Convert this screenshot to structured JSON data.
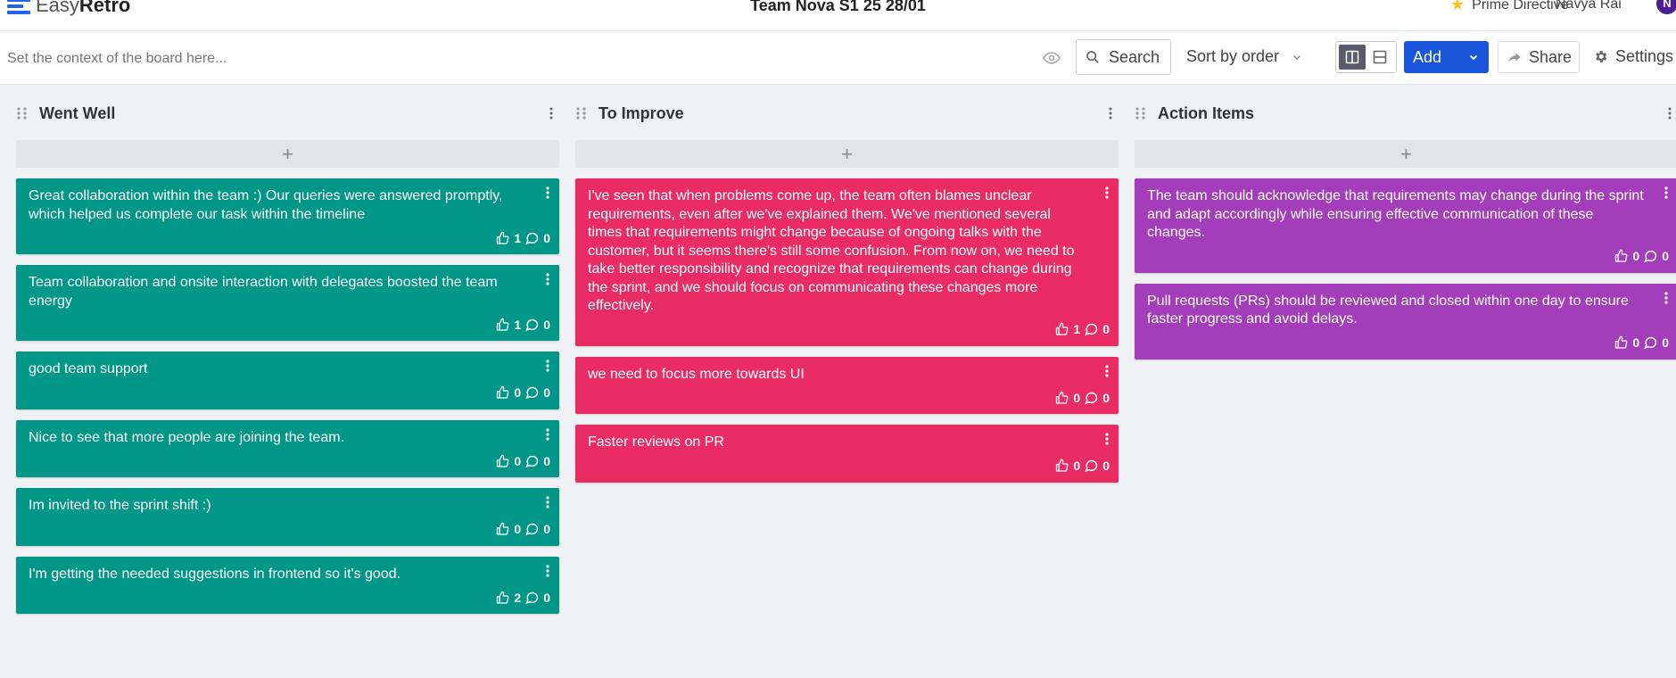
{
  "app": {
    "logo_light": "Easy",
    "logo_bold": "Retro"
  },
  "header": {
    "board_title": "Team Nova S1 25 28/01",
    "prime_directive": "Prime Directive",
    "user_name": "Navya Rai",
    "avatar_initial": "N"
  },
  "toolbar": {
    "context_placeholder": "Set the context of the board here...",
    "search_label": "Search",
    "sort_label": "Sort by order",
    "add_label": "Add",
    "share_label": "Share",
    "settings_label": "Settings"
  },
  "colors": {
    "went_well": "#009688",
    "to_improve": "#e92c64",
    "action_items": "#a33dba",
    "accent": "#1a56db"
  },
  "columns": [
    {
      "title": "Went Well",
      "cards": [
        {
          "text": "Great collaboration within the team :) Our queries were answered promptly, which helped us complete our task within the timeline",
          "likes": "1",
          "comments": "0"
        },
        {
          "text": "Team collaboration and onsite interaction with delegates boosted the team energy",
          "likes": "1",
          "comments": "0"
        },
        {
          "text": "good team support",
          "likes": "0",
          "comments": "0"
        },
        {
          "text": "Nice to see that more people are joining the team.",
          "likes": "0",
          "comments": "0"
        },
        {
          "text": "Im invited to the sprint shift :)",
          "likes": "0",
          "comments": "0"
        },
        {
          "text": "I'm getting the needed suggestions in frontend so it's good.",
          "likes": "2",
          "comments": "0"
        }
      ]
    },
    {
      "title": "To Improve",
      "cards": [
        {
          "text": "I've seen that when problems come up, the team often blames unclear requirements, even after we've explained them. We've mentioned several times that requirements might change because of ongoing talks with the customer, but it seems there's still some confusion. From now on, we need to take better responsibility and recognize that requirements can change during the sprint, and we should focus on communicating these changes more effectively.",
          "likes": "1",
          "comments": "0"
        },
        {
          "text": "we need to focus more towards UI",
          "likes": "0",
          "comments": "0"
        },
        {
          "text": "Faster reviews on PR",
          "likes": "0",
          "comments": "0"
        }
      ]
    },
    {
      "title": "Action Items",
      "cards": [
        {
          "text": "The team should acknowledge that requirements may change during the sprint and adapt accordingly while ensuring effective communication of these changes.",
          "likes": "0",
          "comments": "0"
        },
        {
          "text": "Pull requests (PRs) should be reviewed and closed within one day to ensure faster progress and avoid delays.",
          "likes": "0",
          "comments": "0"
        }
      ]
    }
  ]
}
